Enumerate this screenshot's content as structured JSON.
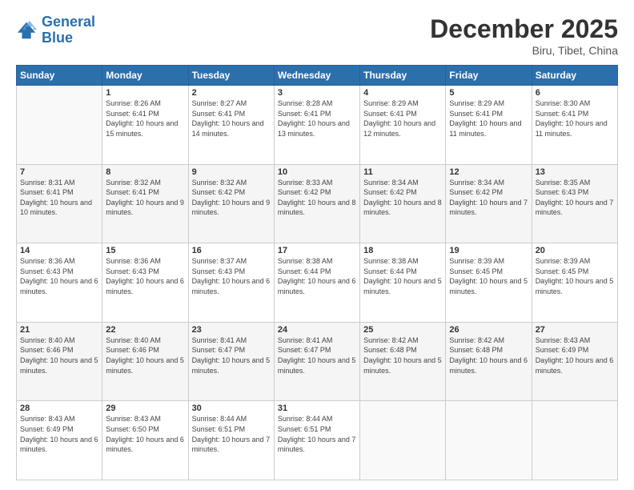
{
  "logo": {
    "line1": "General",
    "line2": "Blue"
  },
  "title": "December 2025",
  "subtitle": "Biru, Tibet, China",
  "headers": [
    "Sunday",
    "Monday",
    "Tuesday",
    "Wednesday",
    "Thursday",
    "Friday",
    "Saturday"
  ],
  "weeks": [
    [
      {
        "day": "",
        "sunrise": "",
        "sunset": "",
        "daylight": "",
        "empty": true
      },
      {
        "day": "1",
        "sunrise": "Sunrise: 8:26 AM",
        "sunset": "Sunset: 6:41 PM",
        "daylight": "Daylight: 10 hours and 15 minutes."
      },
      {
        "day": "2",
        "sunrise": "Sunrise: 8:27 AM",
        "sunset": "Sunset: 6:41 PM",
        "daylight": "Daylight: 10 hours and 14 minutes."
      },
      {
        "day": "3",
        "sunrise": "Sunrise: 8:28 AM",
        "sunset": "Sunset: 6:41 PM",
        "daylight": "Daylight: 10 hours and 13 minutes."
      },
      {
        "day": "4",
        "sunrise": "Sunrise: 8:29 AM",
        "sunset": "Sunset: 6:41 PM",
        "daylight": "Daylight: 10 hours and 12 minutes."
      },
      {
        "day": "5",
        "sunrise": "Sunrise: 8:29 AM",
        "sunset": "Sunset: 6:41 PM",
        "daylight": "Daylight: 10 hours and 11 minutes."
      },
      {
        "day": "6",
        "sunrise": "Sunrise: 8:30 AM",
        "sunset": "Sunset: 6:41 PM",
        "daylight": "Daylight: 10 hours and 11 minutes."
      }
    ],
    [
      {
        "day": "7",
        "sunrise": "Sunrise: 8:31 AM",
        "sunset": "Sunset: 6:41 PM",
        "daylight": "Daylight: 10 hours and 10 minutes."
      },
      {
        "day": "8",
        "sunrise": "Sunrise: 8:32 AM",
        "sunset": "Sunset: 6:41 PM",
        "daylight": "Daylight: 10 hours and 9 minutes."
      },
      {
        "day": "9",
        "sunrise": "Sunrise: 8:32 AM",
        "sunset": "Sunset: 6:42 PM",
        "daylight": "Daylight: 10 hours and 9 minutes."
      },
      {
        "day": "10",
        "sunrise": "Sunrise: 8:33 AM",
        "sunset": "Sunset: 6:42 PM",
        "daylight": "Daylight: 10 hours and 8 minutes."
      },
      {
        "day": "11",
        "sunrise": "Sunrise: 8:34 AM",
        "sunset": "Sunset: 6:42 PM",
        "daylight": "Daylight: 10 hours and 8 minutes."
      },
      {
        "day": "12",
        "sunrise": "Sunrise: 8:34 AM",
        "sunset": "Sunset: 6:42 PM",
        "daylight": "Daylight: 10 hours and 7 minutes."
      },
      {
        "day": "13",
        "sunrise": "Sunrise: 8:35 AM",
        "sunset": "Sunset: 6:43 PM",
        "daylight": "Daylight: 10 hours and 7 minutes."
      }
    ],
    [
      {
        "day": "14",
        "sunrise": "Sunrise: 8:36 AM",
        "sunset": "Sunset: 6:43 PM",
        "daylight": "Daylight: 10 hours and 6 minutes."
      },
      {
        "day": "15",
        "sunrise": "Sunrise: 8:36 AM",
        "sunset": "Sunset: 6:43 PM",
        "daylight": "Daylight: 10 hours and 6 minutes."
      },
      {
        "day": "16",
        "sunrise": "Sunrise: 8:37 AM",
        "sunset": "Sunset: 6:43 PM",
        "daylight": "Daylight: 10 hours and 6 minutes."
      },
      {
        "day": "17",
        "sunrise": "Sunrise: 8:38 AM",
        "sunset": "Sunset: 6:44 PM",
        "daylight": "Daylight: 10 hours and 6 minutes."
      },
      {
        "day": "18",
        "sunrise": "Sunrise: 8:38 AM",
        "sunset": "Sunset: 6:44 PM",
        "daylight": "Daylight: 10 hours and 5 minutes."
      },
      {
        "day": "19",
        "sunrise": "Sunrise: 8:39 AM",
        "sunset": "Sunset: 6:45 PM",
        "daylight": "Daylight: 10 hours and 5 minutes."
      },
      {
        "day": "20",
        "sunrise": "Sunrise: 8:39 AM",
        "sunset": "Sunset: 6:45 PM",
        "daylight": "Daylight: 10 hours and 5 minutes."
      }
    ],
    [
      {
        "day": "21",
        "sunrise": "Sunrise: 8:40 AM",
        "sunset": "Sunset: 6:46 PM",
        "daylight": "Daylight: 10 hours and 5 minutes."
      },
      {
        "day": "22",
        "sunrise": "Sunrise: 8:40 AM",
        "sunset": "Sunset: 6:46 PM",
        "daylight": "Daylight: 10 hours and 5 minutes."
      },
      {
        "day": "23",
        "sunrise": "Sunrise: 8:41 AM",
        "sunset": "Sunset: 6:47 PM",
        "daylight": "Daylight: 10 hours and 5 minutes."
      },
      {
        "day": "24",
        "sunrise": "Sunrise: 8:41 AM",
        "sunset": "Sunset: 6:47 PM",
        "daylight": "Daylight: 10 hours and 5 minutes."
      },
      {
        "day": "25",
        "sunrise": "Sunrise: 8:42 AM",
        "sunset": "Sunset: 6:48 PM",
        "daylight": "Daylight: 10 hours and 5 minutes."
      },
      {
        "day": "26",
        "sunrise": "Sunrise: 8:42 AM",
        "sunset": "Sunset: 6:48 PM",
        "daylight": "Daylight: 10 hours and 6 minutes."
      },
      {
        "day": "27",
        "sunrise": "Sunrise: 8:43 AM",
        "sunset": "Sunset: 6:49 PM",
        "daylight": "Daylight: 10 hours and 6 minutes."
      }
    ],
    [
      {
        "day": "28",
        "sunrise": "Sunrise: 8:43 AM",
        "sunset": "Sunset: 6:49 PM",
        "daylight": "Daylight: 10 hours and 6 minutes."
      },
      {
        "day": "29",
        "sunrise": "Sunrise: 8:43 AM",
        "sunset": "Sunset: 6:50 PM",
        "daylight": "Daylight: 10 hours and 6 minutes."
      },
      {
        "day": "30",
        "sunrise": "Sunrise: 8:44 AM",
        "sunset": "Sunset: 6:51 PM",
        "daylight": "Daylight: 10 hours and 7 minutes."
      },
      {
        "day": "31",
        "sunrise": "Sunrise: 8:44 AM",
        "sunset": "Sunset: 6:51 PM",
        "daylight": "Daylight: 10 hours and 7 minutes."
      },
      {
        "day": "",
        "sunrise": "",
        "sunset": "",
        "daylight": "",
        "empty": true
      },
      {
        "day": "",
        "sunrise": "",
        "sunset": "",
        "daylight": "",
        "empty": true
      },
      {
        "day": "",
        "sunrise": "",
        "sunset": "",
        "daylight": "",
        "empty": true
      }
    ]
  ]
}
